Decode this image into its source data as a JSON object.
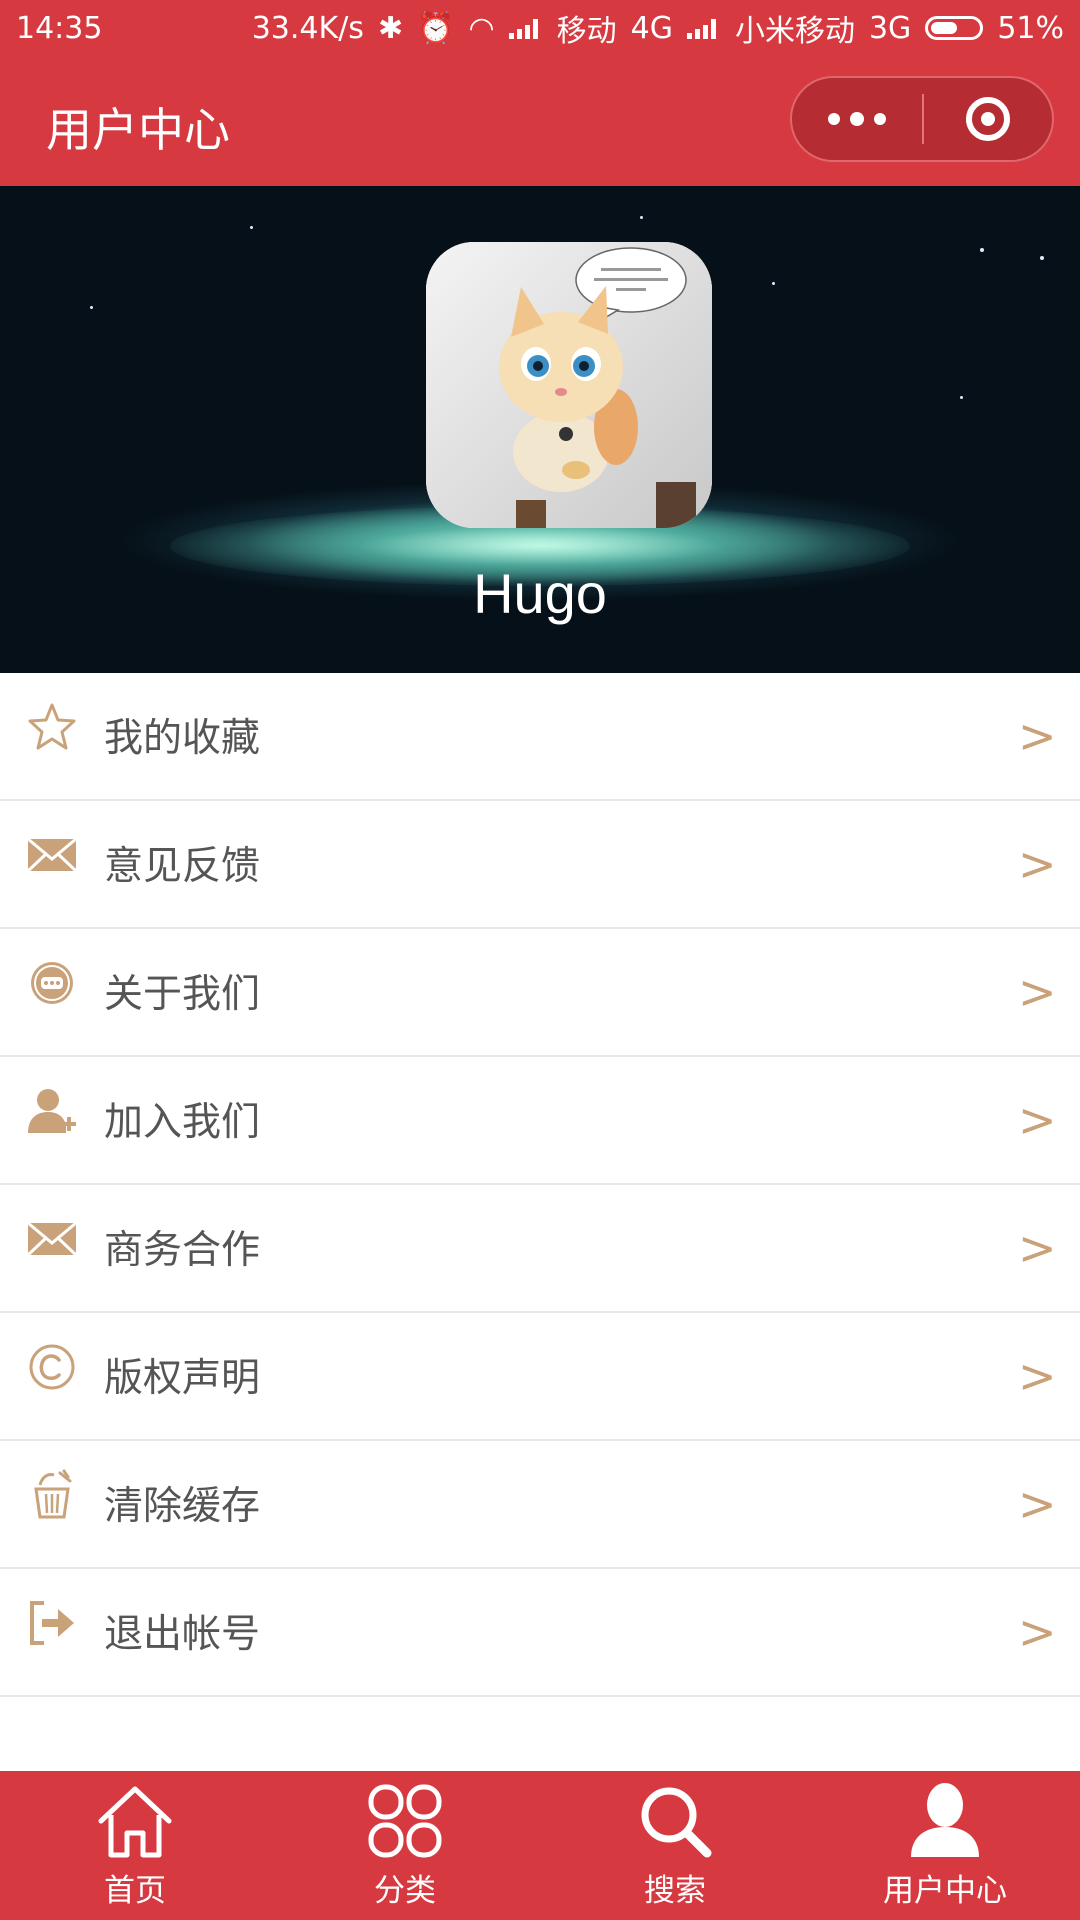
{
  "status_bar": {
    "time": "14:35",
    "speed": "33.4K/s",
    "carrier1": "移动",
    "network1": "4G",
    "carrier2": "小米移动",
    "network2": "3G",
    "battery": "51%"
  },
  "header": {
    "title": "用户中心",
    "more_icon": "more-dots-icon",
    "close_icon": "target-circle-icon"
  },
  "profile": {
    "username": "Hugo"
  },
  "menu": {
    "items": [
      {
        "label": "我的收藏",
        "icon": "star-icon",
        "arrow": ">"
      },
      {
        "label": "意见反馈",
        "icon": "envelope-icon",
        "arrow": ">"
      },
      {
        "label": "关于我们",
        "icon": "chat-bubble-icon",
        "arrow": ">"
      },
      {
        "label": "加入我们",
        "icon": "add-user-icon",
        "arrow": ">"
      },
      {
        "label": "商务合作",
        "icon": "envelope-icon",
        "arrow": ">"
      },
      {
        "label": "版权声明",
        "icon": "copyright-icon",
        "arrow": ">"
      },
      {
        "label": "清除缓存",
        "icon": "trash-icon",
        "arrow": ">"
      },
      {
        "label": "退出帐号",
        "icon": "logout-icon",
        "arrow": ">"
      }
    ]
  },
  "tabbar": {
    "tabs": [
      {
        "label": "首页",
        "icon": "home-icon"
      },
      {
        "label": "分类",
        "icon": "grid-icon"
      },
      {
        "label": "搜索",
        "icon": "search-icon"
      },
      {
        "label": "用户中心",
        "icon": "user-icon",
        "active": true
      }
    ]
  },
  "colors": {
    "brand_red": "#d63a40",
    "accent_gold": "#c9a27a",
    "text": "#555555"
  }
}
